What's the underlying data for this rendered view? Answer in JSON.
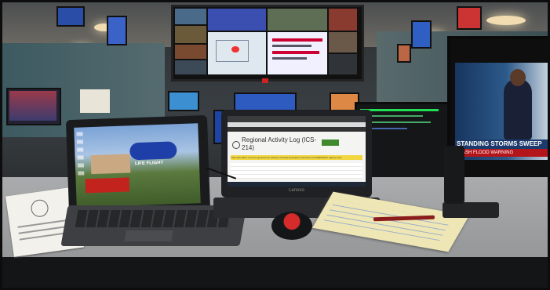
{
  "laptop_center": {
    "brand": "Lenovo",
    "page_heading": "Regional Activity Log (ICS-214)",
    "info_banner": "This information is for the general use between Kansas Emergency Services and KDEM/EOC agency only."
  },
  "tv_right": {
    "ticker": "STANDING STORMS SWEEP",
    "ticker_sub": "FLASH FLOOD WARNING"
  },
  "wall_display": {
    "panel_1": "",
    "panel_2": ""
  },
  "tablet": {
    "vehicle_text": "LIFE FLIGHT"
  },
  "colors": {
    "wall": "#2f3335",
    "desk": "#9b9d9e",
    "ceiling_light": "#f0dcb0",
    "tv_blue": "#1c3a6b",
    "banner_yellow": "#f1d640",
    "header_green": "#3f8a2d"
  }
}
